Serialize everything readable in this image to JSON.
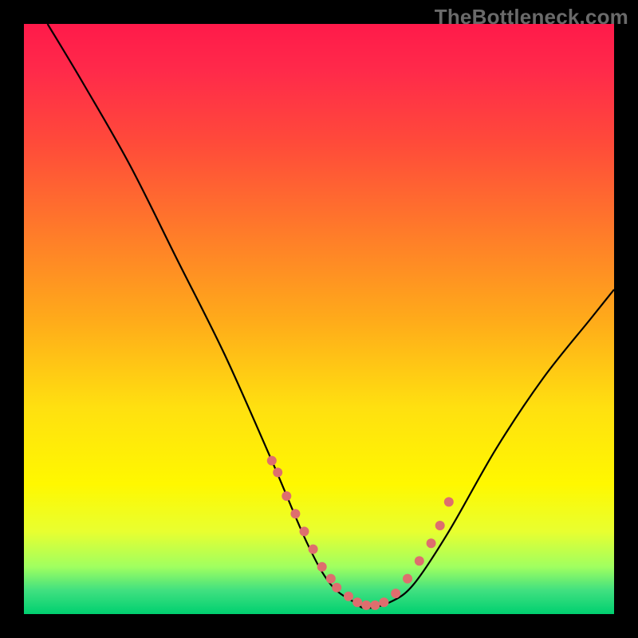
{
  "watermark": "TheBottleneck.com",
  "chart_data": {
    "type": "line",
    "title": "",
    "xlabel": "",
    "ylabel": "",
    "xlim": [
      0,
      100
    ],
    "ylim": [
      0,
      100
    ],
    "series": [
      {
        "name": "curve",
        "x": [
          4,
          10,
          18,
          26,
          34,
          42,
          48,
          52,
          56,
          58,
          62,
          66,
          72,
          80,
          88,
          96,
          100
        ],
        "y": [
          100,
          90,
          76,
          60,
          44,
          26,
          12,
          5,
          2,
          1,
          2,
          5,
          14,
          28,
          40,
          50,
          55
        ]
      }
    ],
    "markers": {
      "name": "highlight-dots",
      "color": "#de6e6e",
      "x": [
        42,
        43,
        44.5,
        46,
        47.5,
        49,
        50.5,
        52,
        53,
        55,
        56.5,
        58,
        59.5,
        61,
        63,
        65,
        67,
        69,
        70.5,
        72
      ],
      "y": [
        26,
        24,
        20,
        17,
        14,
        11,
        8,
        6,
        4.5,
        3,
        2,
        1.5,
        1.5,
        2,
        3.5,
        6,
        9,
        12,
        15,
        19
      ]
    }
  }
}
